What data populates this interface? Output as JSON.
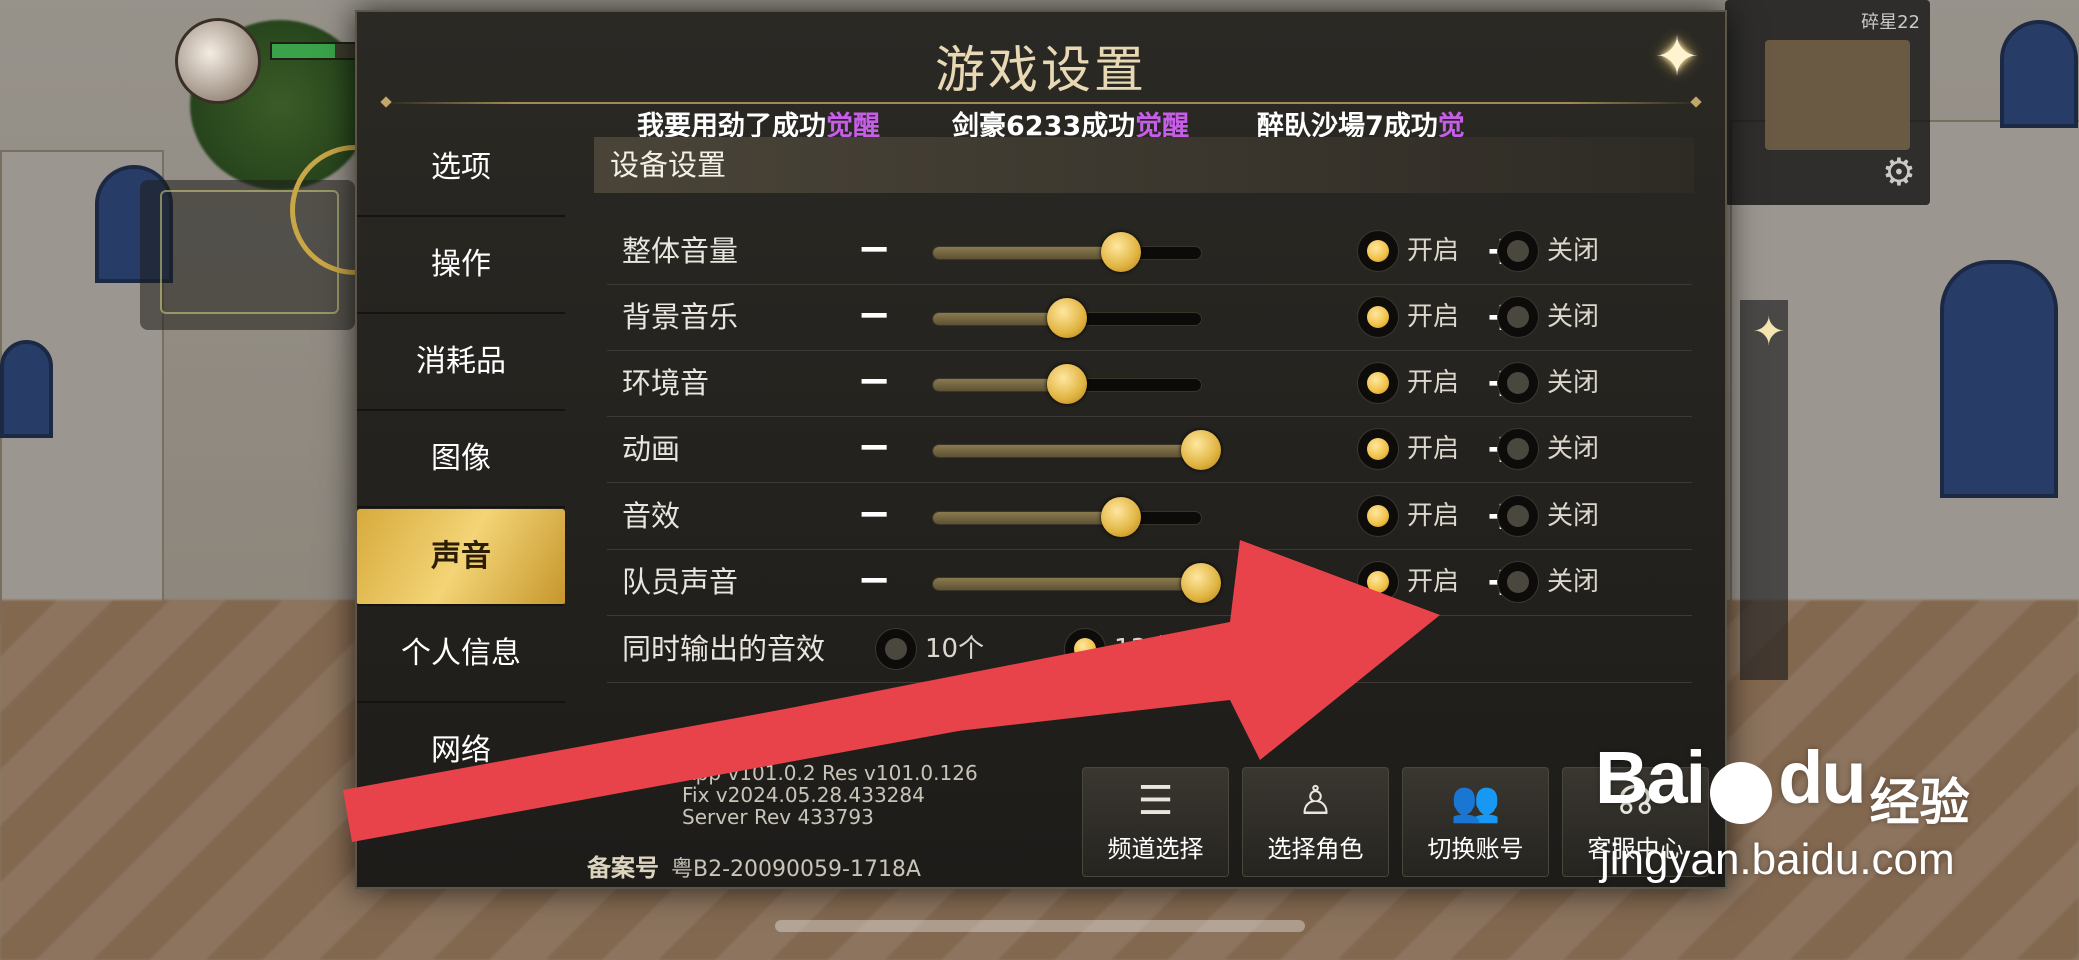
{
  "dialog": {
    "title": "游戏设置",
    "close_icon": "close-star-icon"
  },
  "ticker": [
    {
      "prefix": "我要用劲了成功",
      "suffix": "觉醒"
    },
    {
      "prefix": "剑豪6233成功",
      "suffix": "觉醒"
    },
    {
      "prefix": "醉臥沙場7成功",
      "suffix": "觉"
    }
  ],
  "sidebar": {
    "items": [
      {
        "label": "选项",
        "active": false
      },
      {
        "label": "操作",
        "active": false
      },
      {
        "label": "消耗品",
        "active": false
      },
      {
        "label": "图像",
        "active": false
      },
      {
        "label": "声音",
        "active": true
      },
      {
        "label": "个人信息",
        "active": false
      },
      {
        "label": "网络",
        "active": false
      }
    ]
  },
  "section": {
    "title": "设备设置"
  },
  "sound_rows": [
    {
      "label": "整体音量",
      "level": 0.7,
      "on_label": "开启",
      "off_label": "关闭",
      "state": "on"
    },
    {
      "label": "背景音乐",
      "level": 0.5,
      "on_label": "开启",
      "off_label": "关闭",
      "state": "on"
    },
    {
      "label": "环境音",
      "level": 0.5,
      "on_label": "开启",
      "off_label": "关闭",
      "state": "on"
    },
    {
      "label": "动画",
      "level": 1.0,
      "on_label": "开启",
      "off_label": "关闭",
      "state": "on"
    },
    {
      "label": "音效",
      "level": 0.7,
      "on_label": "开启",
      "off_label": "关闭",
      "state": "on"
    },
    {
      "label": "队员声音",
      "level": 1.0,
      "on_label": "开启",
      "off_label": "关闭",
      "state": "on"
    }
  ],
  "simultaneous": {
    "label": "同时输出的音效",
    "options": [
      "10个",
      "13个"
    ],
    "selected": "13个"
  },
  "version": {
    "line1": "App v101.0.2 Res v101.0.126",
    "line2": "Fix v2024.05.28.433284",
    "line3": "Server Rev 433793"
  },
  "record": {
    "label": "备案号",
    "value": "粤B2-20090059-1718A"
  },
  "footer_buttons": [
    {
      "label": "频道选择",
      "icon": "list-icon"
    },
    {
      "label": "选择角色",
      "icon": "character-icon"
    },
    {
      "label": "切换账号",
      "icon": "group-icon"
    },
    {
      "label": "客服中心",
      "icon": "headset-icon"
    }
  ],
  "hud": {
    "status": "碎星22"
  },
  "watermark": {
    "brand": "Bai",
    "brand_tail": "du",
    "cn": "经验",
    "url": "jingyan.baidu.com"
  },
  "colors": {
    "accent_gold": "#f0c045",
    "awakening_purple": "#c65ee8",
    "arrow_red": "#e8434a"
  }
}
